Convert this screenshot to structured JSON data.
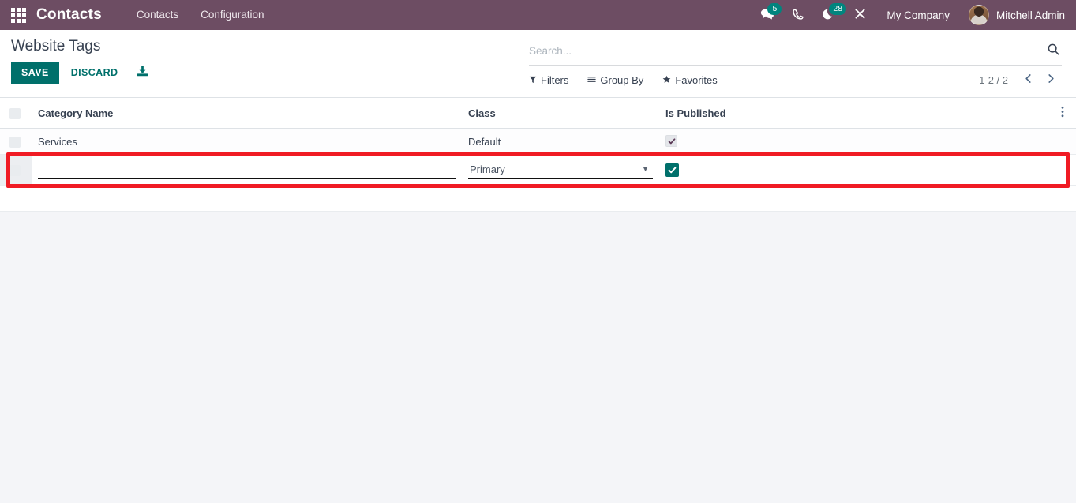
{
  "navbar": {
    "apps_icon": "apps-grid-icon",
    "brand": "Contacts",
    "menus": [
      {
        "label": "Contacts"
      },
      {
        "label": "Configuration"
      }
    ],
    "systray": [
      {
        "icon": "messaging-icon",
        "name": "messages-counter",
        "badge": "5"
      },
      {
        "icon": "phone-icon",
        "name": "voip-phone",
        "badge": ""
      },
      {
        "icon": "activity-clock-icon",
        "name": "activities-counter",
        "badge": "28"
      },
      {
        "icon": "tools-icon",
        "name": "debug-tools",
        "badge": ""
      }
    ],
    "company": "My Company",
    "user_name": "Mitchell Admin",
    "bg_color": "#6d4d63",
    "badge_color": "#00857e"
  },
  "control_panel": {
    "breadcrumb": "Website Tags",
    "save_label": "SAVE",
    "discard_label": "DISCARD",
    "export_icon": "download-export-icon",
    "accent_color": "#00706b"
  },
  "search": {
    "placeholder": "Search...",
    "value": "",
    "search_icon": "search-icon",
    "filters_label": "Filters",
    "group_by_label": "Group By",
    "favorites_label": "Favorites"
  },
  "pager": {
    "value": "1-2 / 2",
    "previous_icon": "chevron-left-icon",
    "next_icon": "chevron-right-icon"
  },
  "list": {
    "columns": [
      {
        "label": "Category Name"
      },
      {
        "label": "Class"
      },
      {
        "label": "Is Published"
      }
    ],
    "optional_columns_icon": "vertical-dots-icon",
    "rows": [
      {
        "category_name": "Services",
        "class": "Default",
        "is_published": true,
        "editing": false
      },
      {
        "category_name": "",
        "class": "Primary",
        "class_options": [
          "Primary"
        ],
        "is_published": true,
        "editing": true
      }
    ]
  },
  "highlight": {
    "color": "#f01b24"
  }
}
